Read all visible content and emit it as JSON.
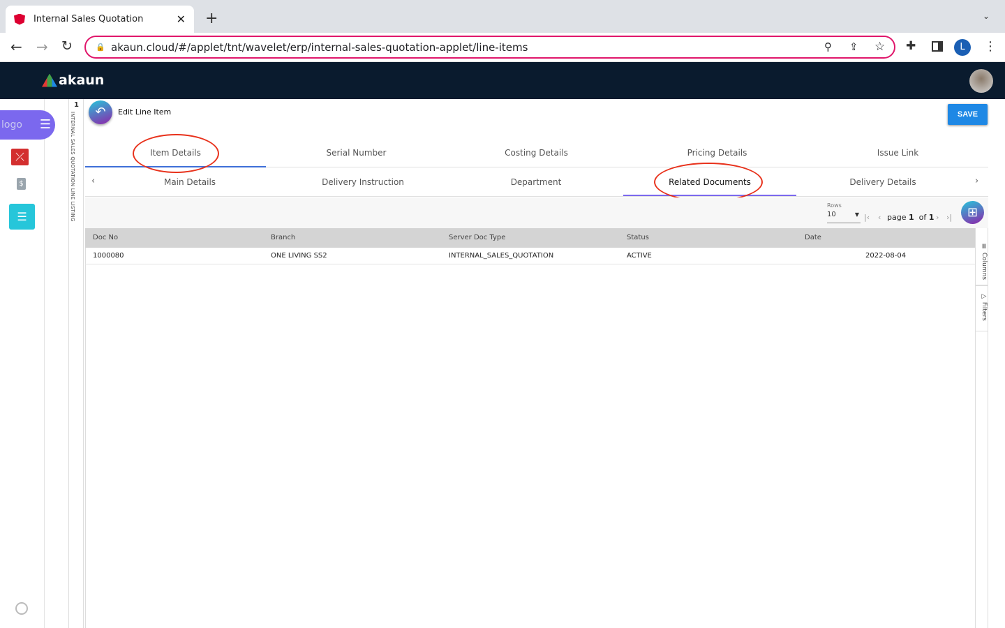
{
  "browser": {
    "tab_title": "Internal Sales Quotation",
    "url": "akaun.cloud/#/applet/tnt/wavelet/erp/internal-sales-quotation-applet/line-items",
    "profile_initial": "L"
  },
  "app": {
    "brand": "akaun",
    "logo_alt": "logo"
  },
  "page": {
    "vertical_counter": "1",
    "vertical_label": "INTERNAL SALES QUOTATION LINE LISTING",
    "title": "Edit Line Item",
    "save_label": "SAVE"
  },
  "tabs_primary": [
    {
      "label": "Item Details",
      "active": true
    },
    {
      "label": "Serial Number"
    },
    {
      "label": "Costing Details"
    },
    {
      "label": "Pricing Details"
    },
    {
      "label": "Issue Link"
    }
  ],
  "tabs_secondary": [
    {
      "label": "Main Details"
    },
    {
      "label": "Delivery Instruction"
    },
    {
      "label": "Department"
    },
    {
      "label": "Related Documents",
      "active": true
    },
    {
      "label": "Delivery Details"
    }
  ],
  "pagination": {
    "rows_label": "Rows",
    "rows_value": "10",
    "page_label": "page",
    "page": "1",
    "of_label": "of",
    "total": "1"
  },
  "table": {
    "columns": [
      "Doc No",
      "Branch",
      "Server Doc Type",
      "Status",
      "Date"
    ],
    "rows": [
      [
        "1000080",
        "ONE LIVING SS2",
        "INTERNAL_SALES_QUOTATION",
        "ACTIVE",
        "2022-08-04"
      ]
    ]
  },
  "side_panel": {
    "columns_label": "Columns",
    "filters_label": "Filters"
  },
  "colors": {
    "accent": "#1e88e5",
    "header": "#0a1b2e",
    "annotation": "#e8321c",
    "tab_underline": "#3f6fd8"
  }
}
